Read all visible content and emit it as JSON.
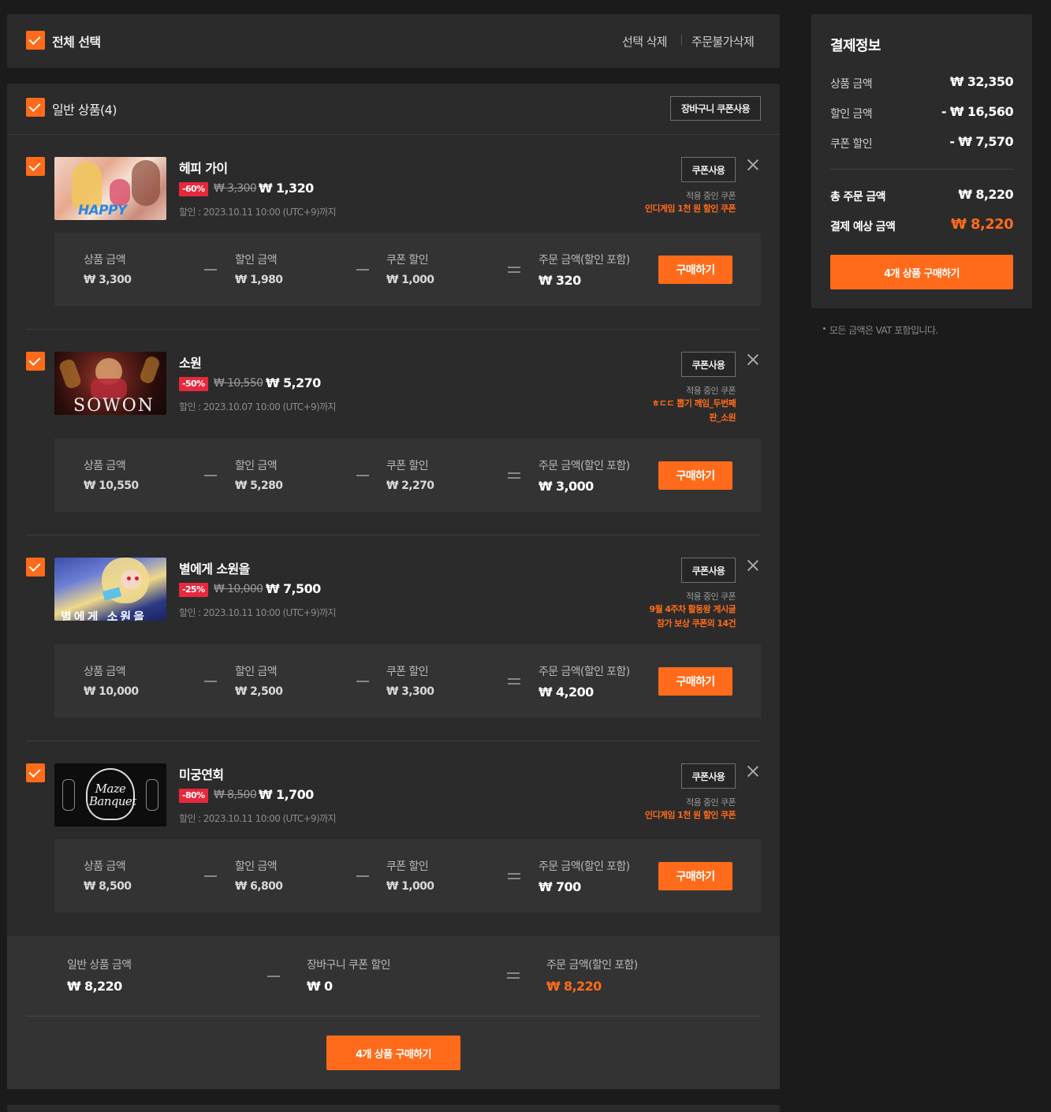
{
  "top_bar": {
    "select_all": "전체 선택",
    "delete_selected": "선택 삭제",
    "delete_unavailable": "주문불가삭제"
  },
  "group": {
    "title": "일반 상품(4)",
    "cart_coupon_button": "장바구니 쿠폰사용"
  },
  "common": {
    "coupon_button": "쿠폰사용",
    "applied_coupon_label": "적용 중인 쿠폰",
    "buy_button": "구매하기",
    "label_price": "상품 금액",
    "label_discount": "할인 금액",
    "label_coupon": "쿠폰 할인",
    "label_order": "주문 금액(할인 포함)"
  },
  "items": [
    {
      "name": "헤피 가이",
      "discount_pct": "-60%",
      "original_price": "₩ 3,300",
      "sale_price": "₩ 1,320",
      "sale_period": "할인 : 2023.10.11 10:00 (UTC+9)까지",
      "coupon_line1": "인디게임 1천 원 할인 쿠폰",
      "coupon_line2": "",
      "price": "₩ 3,300",
      "discount": "₩ 1,980",
      "coupon_discount": "₩ 1,000",
      "order_total": "₩ 320",
      "thumb_text": "HAPPY"
    },
    {
      "name": "소원",
      "discount_pct": "-50%",
      "original_price": "₩ 10,550",
      "sale_price": "₩ 5,270",
      "sale_period": "할인 : 2023.10.07 10:00 (UTC+9)까지",
      "coupon_line1": "ㅎㄷㄷ 뽑기 께임_두번째",
      "coupon_line2": "판_소원",
      "price": "₩ 10,550",
      "discount": "₩ 5,280",
      "coupon_discount": "₩ 2,270",
      "order_total": "₩ 3,000",
      "thumb_text": "SOWON"
    },
    {
      "name": "별에게 소원을",
      "discount_pct": "-25%",
      "original_price": "₩ 10,000",
      "sale_price": "₩ 7,500",
      "sale_period": "할인 : 2023.10.11 10:00 (UTC+9)까지",
      "coupon_line1": "9월 4주차 활동왕 게시글",
      "coupon_line2": "참가 보상 쿠폰외 14건",
      "price": "₩ 10,000",
      "discount": "₩ 2,500",
      "coupon_discount": "₩ 3,300",
      "order_total": "₩ 4,200",
      "thumb_text": "별에게 소원을"
    },
    {
      "name": "미궁연회",
      "discount_pct": "-80%",
      "original_price": "₩ 8,500",
      "sale_price": "₩ 1,700",
      "sale_period": "할인 : 2023.10.11 10:00 (UTC+9)까지",
      "coupon_line1": "인디게임 1천 원 할인 쿠폰",
      "coupon_line2": "",
      "price": "₩ 8,500",
      "discount": "₩ 6,800",
      "coupon_discount": "₩ 1,000",
      "order_total": "₩ 700",
      "thumb_text": "Maze Banquet"
    }
  ],
  "group_summary": {
    "label_general": "일반 상품 금액",
    "value_general": "₩ 8,220",
    "label_cart_coupon": "장바구니 쿠폰 할인",
    "value_cart_coupon": "₩ 0",
    "label_order": "주문 금액(할인 포함)",
    "value_order": "₩ 8,220",
    "buy_all_button": "4개 상품 구매하기"
  },
  "payment": {
    "title": "결제정보",
    "rows": [
      {
        "label": "상품 금액",
        "value": "₩ 32,350"
      },
      {
        "label": "할인 금액",
        "value": "- ₩ 16,560"
      },
      {
        "label": "쿠폰 할인",
        "value": "- ₩ 7,570"
      }
    ],
    "total_label": "총 주문 금액",
    "total_value": "₩ 8,220",
    "expected_label": "결제 예상 금액",
    "expected_value": "₩ 8,220",
    "buy_button": "4개 상품 구매하기",
    "vat_note": "모든 금액은 VAT 포함입니다."
  },
  "colors": {
    "accent": "#ff6b1a",
    "badge_red": "#e8283c",
    "panel": "#2b2b2b",
    "background": "#1b1b1b"
  }
}
